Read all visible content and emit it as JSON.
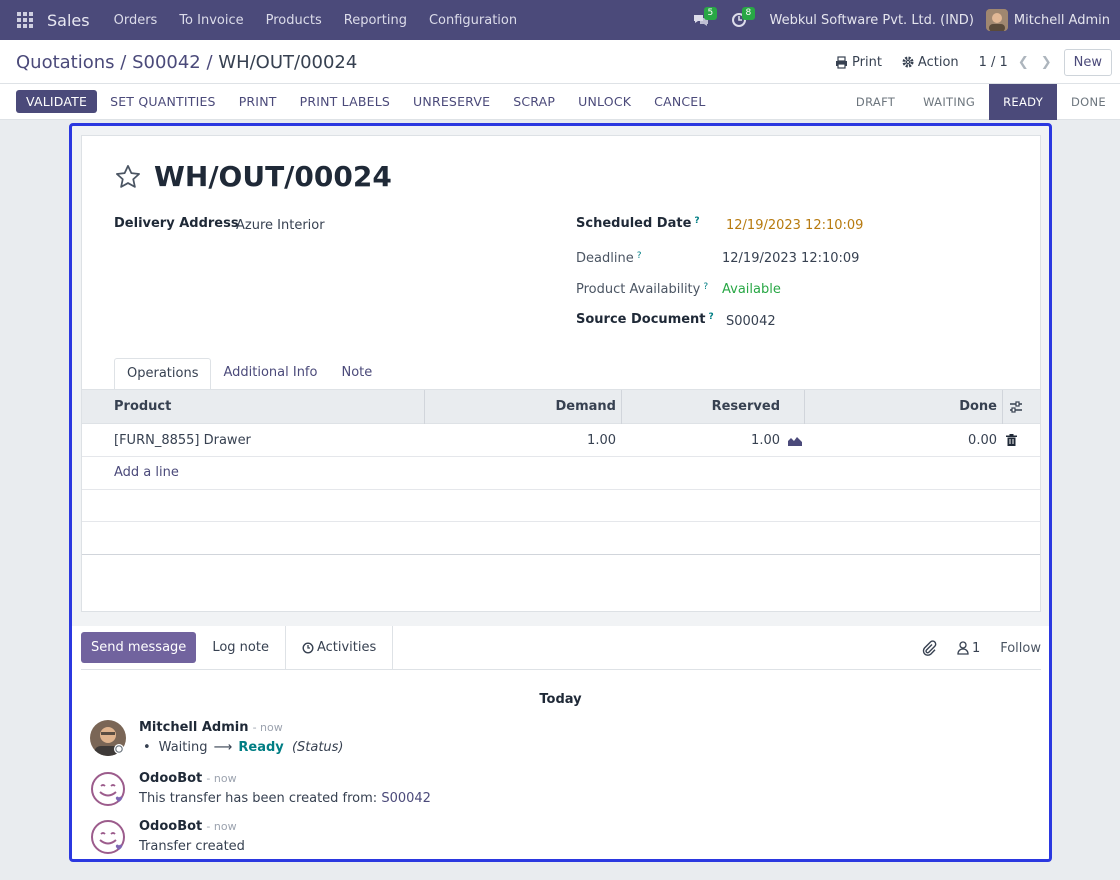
{
  "topbar": {
    "app_name": "Sales",
    "menu": [
      "Orders",
      "To Invoice",
      "Products",
      "Reporting",
      "Configuration"
    ],
    "messages_count": "5",
    "activities_count": "8",
    "company": "Webkul Software Pvt. Ltd. (IND)",
    "user": "Mitchell Admin"
  },
  "breadcrumb": {
    "part1": "Quotations",
    "sep1": " / ",
    "part2": "S00042",
    "sep2": " / ",
    "current": "WH/OUT/00024"
  },
  "control": {
    "print_label": "Print",
    "action_label": "Action",
    "pager": "1 / 1",
    "new_label": "New"
  },
  "actions": {
    "validate": "VALIDATE",
    "set_quantities": "SET QUANTITIES",
    "print": "PRINT",
    "print_labels": "PRINT LABELS",
    "unreserve": "UNRESERVE",
    "scrap": "SCRAP",
    "unlock": "UNLOCK",
    "cancel": "CANCEL"
  },
  "statusbar": {
    "stages": [
      "DRAFT",
      "WAITING",
      "READY",
      "DONE"
    ],
    "current": "READY"
  },
  "record": {
    "name": "WH/OUT/00024",
    "delivery_address_label": "Delivery Address",
    "delivery_address": "Azure Interior",
    "scheduled_date_label": "Scheduled Date",
    "scheduled_date": "12/19/2023 12:10:09",
    "deadline_label": "Deadline",
    "deadline": "12/19/2023 12:10:09",
    "availability_label": "Product Availability",
    "availability": "Available",
    "source_label": "Source Document",
    "source": "S00042",
    "help_mark": "?"
  },
  "tabs": [
    "Operations",
    "Additional Info",
    "Note"
  ],
  "operations": {
    "headers": {
      "product": "Product",
      "demand": "Demand",
      "reserved": "Reserved",
      "done": "Done"
    },
    "rows": [
      {
        "product": "[FURN_8855] Drawer",
        "demand": "1.00",
        "reserved": "1.00",
        "done": "0.00"
      }
    ],
    "add_line": "Add a line"
  },
  "chatter": {
    "send_message": "Send message",
    "log_note": "Log note",
    "activities": "Activities",
    "followers_count": "1",
    "follow": "Follow",
    "date_separator": "Today",
    "messages": [
      {
        "author": "Mitchell Admin",
        "time": "- now",
        "old_value": "Waiting",
        "arrow": "⟶",
        "new_value": "Ready",
        "field": "(Status)"
      },
      {
        "author": "OdooBot",
        "time": "- now",
        "text": "This transfer has been created from: ",
        "link": "S00042"
      },
      {
        "author": "OdooBot",
        "time": "- now",
        "text": "Transfer created"
      }
    ]
  },
  "colors": {
    "brand": "#4b4a7a",
    "highlight_frame": "#2b38e0",
    "available": "#28a745",
    "scheduled": "#b77a0f"
  }
}
